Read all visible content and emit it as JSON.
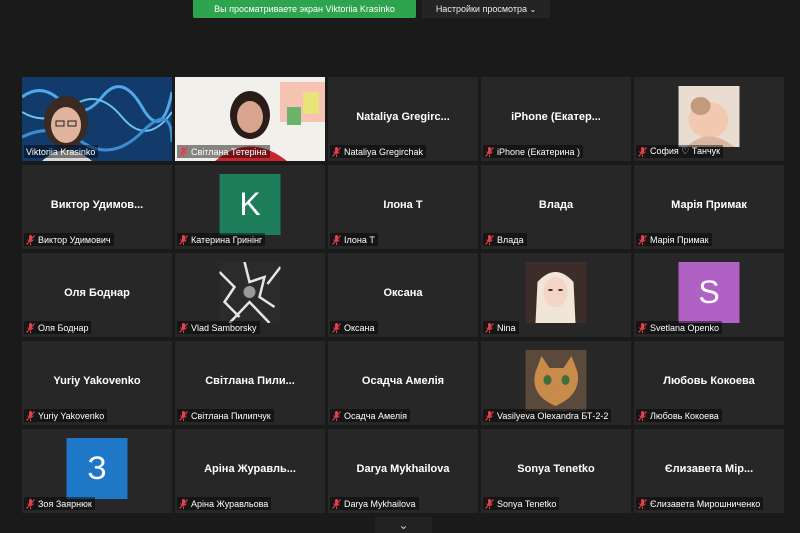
{
  "banner": {
    "share_text": "Вы просматриваете экран Viktoriia Krasinko",
    "view_options": "Настройки просмотра"
  },
  "participants": [
    {
      "label": "Viktoriia Krasinko"
    },
    {
      "label": "Світлана Тетеріна"
    },
    {
      "label": "Nataliya Gregirchak",
      "big": "Nataliya  Gregirc..."
    },
    {
      "label": "iPhone (Екатерина )",
      "big": "iPhone  (Екатер..."
    },
    {
      "label": "София ♡ Танчук"
    },
    {
      "label": "Виктор Удимович",
      "big": "Виктор  Удимов..."
    },
    {
      "label": "Катерина Гринінг",
      "initial": "K"
    },
    {
      "label": "Ілона Т",
      "big": "Ілона Т"
    },
    {
      "label": "Влада",
      "big": "Влада"
    },
    {
      "label": "Марія Примак",
      "big": "Марія Примак"
    },
    {
      "label": "Оля Боднар",
      "big": "Оля Боднар"
    },
    {
      "label": "Vlad Samborsky"
    },
    {
      "label": "Оксана",
      "big": "Оксана"
    },
    {
      "label": "Nina"
    },
    {
      "label": "Svetlana Openko",
      "initial": "S"
    },
    {
      "label": "Yuriy Yakovenko",
      "big": "Yuriy Yakovenko"
    },
    {
      "label": "Світлана Пилипчук",
      "big": "Світлана  Пили..."
    },
    {
      "label": "Осадча Амелія",
      "big": "Осадча Амелія"
    },
    {
      "label": "Vasilyeva Olexandra БТ-2-2"
    },
    {
      "label": "Любовь Кокоева",
      "big": "Любовь Кокоева"
    },
    {
      "label": "Зоя Заярнюк",
      "initial": "З"
    },
    {
      "label": "Аріна Журавльова",
      "big": "Аріна  Журавль..."
    },
    {
      "label": "Darya Mykhailova",
      "big": "Darya Mykhailova"
    },
    {
      "label": "Sonya Tenetko",
      "big": "Sonya Tenetko"
    },
    {
      "label": "Єлизавета Мирошниченко",
      "big": "Єлизавета  Мір..."
    }
  ],
  "colors": {
    "share_banner": "#2ea44f",
    "active_speaker": "#f4e45a",
    "muted_mic": "#e0414a",
    "avatar_green": "#1e7e5c",
    "avatar_purple": "#b061c4",
    "avatar_blue": "#1f77c7"
  },
  "icons": {
    "muted": "muted-mic-icon",
    "scroll": "chevron-down-icon",
    "dropdown": "chevron-down-icon"
  }
}
